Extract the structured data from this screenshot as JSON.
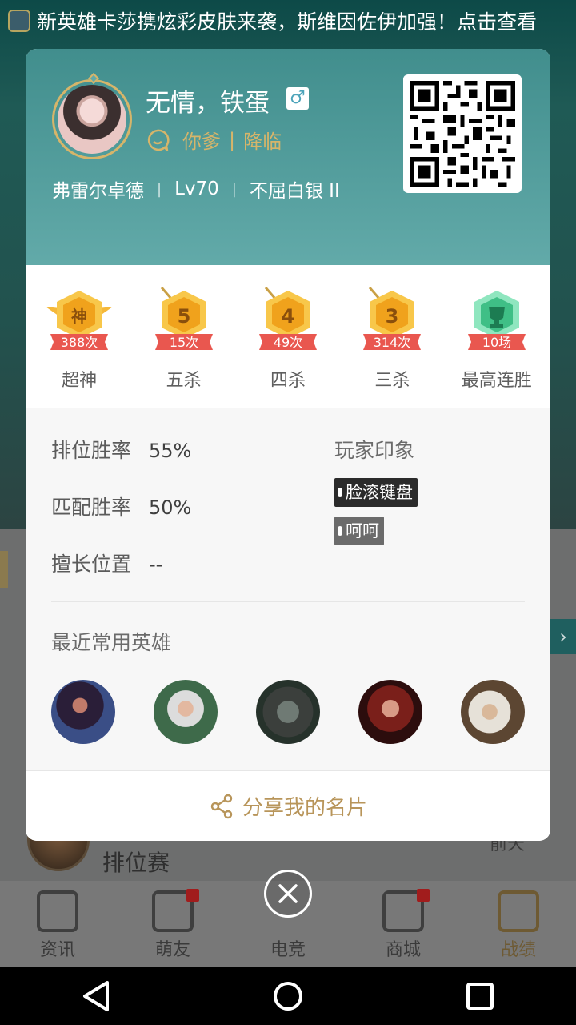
{
  "notice": {
    "text": "新英雄卡莎携炫彩皮肤来袭，斯维因佐伊加强！点击查看"
  },
  "profile": {
    "nickname": "无情，铁蛋",
    "gender_symbol": "♂",
    "tag1": "你爹",
    "tag_sep": "|",
    "tag2": "降临",
    "server": "弗雷尔卓德",
    "level": "Lv70",
    "rank": "不屈白银 II"
  },
  "medals": [
    {
      "badge": "神",
      "count": "388次",
      "label": "超神",
      "color": "gold"
    },
    {
      "badge": "5",
      "count": "15次",
      "label": "五杀",
      "color": "gold"
    },
    {
      "badge": "4",
      "count": "49次",
      "label": "四杀",
      "color": "gold"
    },
    {
      "badge": "3",
      "count": "314次",
      "label": "三杀",
      "color": "gold"
    },
    {
      "badge": "trophy",
      "count": "10场",
      "label": "最高连胜",
      "color": "green"
    }
  ],
  "stats": {
    "ranked_label": "排位胜率",
    "ranked_value": "55%",
    "match_label": "匹配胜率",
    "match_value": "50%",
    "position_label": "擅长位置",
    "position_value": "--"
  },
  "impressions": {
    "title": "玩家印象",
    "tags": [
      "脸滚键盘",
      "呵呵"
    ]
  },
  "recent_heroes": {
    "title": "最近常用英雄"
  },
  "share": {
    "label": "分享我的名片"
  },
  "background": {
    "rank_label": "排位赛",
    "detail_label": "前天"
  },
  "tabs": [
    "资讯",
    "萌友",
    "电竞",
    "商城",
    "战绩"
  ],
  "colors": {
    "accent_gold": "#b8955a",
    "header_teal": "#4f9b9a",
    "medal_gold": "#f5c542",
    "medal_ribbon": "#e9574f",
    "medal_green": "#5ad6a0"
  }
}
